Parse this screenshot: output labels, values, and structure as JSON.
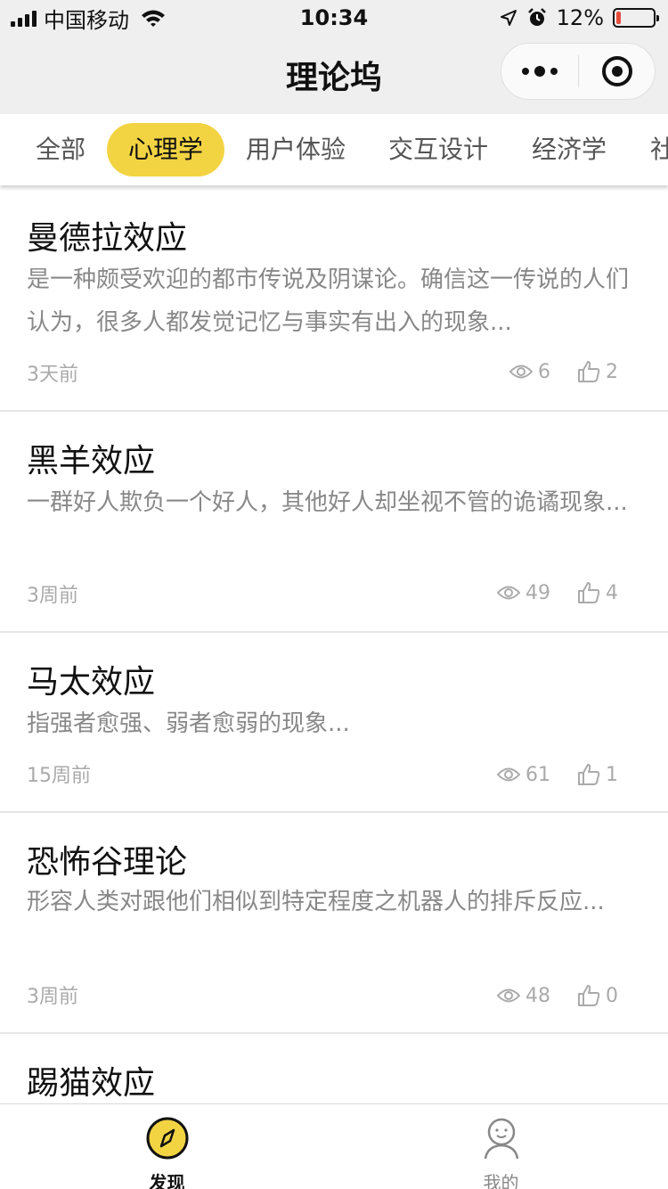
{
  "status_bar": {
    "carrier": "中国移动",
    "time": "10:34",
    "battery_percent": "12%",
    "battery_level": 0.12,
    "battery_color": "#e74c3c"
  },
  "nav": {
    "title": "理论坞"
  },
  "tabs": [
    {
      "label": "全部",
      "active": false
    },
    {
      "label": "心理学",
      "active": true
    },
    {
      "label": "用户体验",
      "active": false
    },
    {
      "label": "交互设计",
      "active": false
    },
    {
      "label": "经济学",
      "active": false
    },
    {
      "label": "社",
      "active": false
    }
  ],
  "accent_color": "#f2d443",
  "articles": [
    {
      "title": "曼德拉效应",
      "desc": "是一种颇受欢迎的都市传说及阴谋论。确信这一传说的人们认为，很多人都发觉记忆与事实有出入的现象...",
      "time": "3天前",
      "views": "6",
      "likes": "2"
    },
    {
      "title": "黑羊效应",
      "desc": "一群好人欺负一个好人，其他好人却坐视不管的诡谲现象...",
      "time": "3周前",
      "views": "49",
      "likes": "4"
    },
    {
      "title": "马太效应",
      "desc": "指强者愈强、弱者愈弱的现象...",
      "time": "15周前",
      "views": "61",
      "likes": "1"
    },
    {
      "title": "恐怖谷理论",
      "desc": "形容人类对跟他们相似到特定程度之机器人的排斥反应...",
      "time": "3周前",
      "views": "48",
      "likes": "0"
    },
    {
      "title": "踢猫效应",
      "desc": "",
      "time": "",
      "views": "",
      "likes": ""
    }
  ],
  "tabbar": [
    {
      "label": "发现",
      "icon": "compass-icon",
      "active": true
    },
    {
      "label": "我的",
      "icon": "person-icon",
      "active": false
    }
  ]
}
